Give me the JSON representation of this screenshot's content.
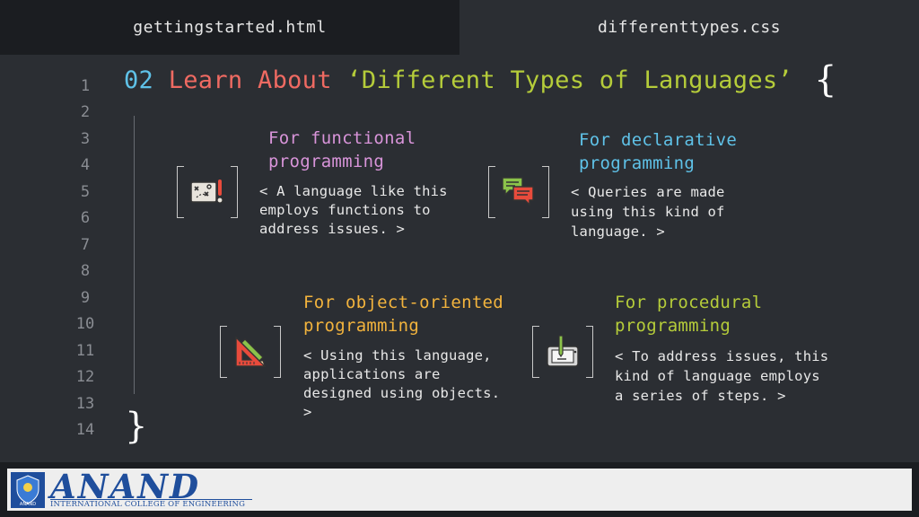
{
  "tabs": [
    {
      "label": "gettingstarted.html",
      "active": true
    },
    {
      "label": "differenttypes.css",
      "active": false
    }
  ],
  "line_numbers": [
    "1",
    "2",
    "3",
    "4",
    "5",
    "6",
    "7",
    "8",
    "9",
    "10",
    "11",
    "12",
    "13",
    "14"
  ],
  "heading": {
    "number": "02",
    "keyword": "Learn About",
    "string": "‘Different Types of Languages’",
    "open_brace": "{",
    "close_brace": "}"
  },
  "items": [
    {
      "title_1": "For functional",
      "title_2": "programming",
      "desc_1": "< A language like this",
      "desc_2": "employs functions to",
      "desc_3": "address issues. >",
      "desc_4": "",
      "icon": "strategy-board-icon",
      "color": "#d894d9"
    },
    {
      "title_1": "For declarative",
      "title_2": "programming",
      "desc_1": "< Queries are made",
      "desc_2": "using this kind of",
      "desc_3": "language. >",
      "desc_4": "",
      "icon": "chat-bubbles-icon",
      "color": "#5fc2e8"
    },
    {
      "title_1": "For object-oriented",
      "title_2": "programming",
      "desc_1": "< Using this language,",
      "desc_2": "applications are",
      "desc_3": "designed using objects.",
      "desc_4": ">",
      "icon": "ruler-pencil-icon",
      "color": "#f2b33d"
    },
    {
      "title_1": "For procedural",
      "title_2": "programming",
      "desc_1": "< To address issues, this",
      "desc_2": "kind of language employs",
      "desc_3": "a series of steps. >",
      "desc_4": "",
      "icon": "drawing-tablet-icon",
      "color": "#b5cc3a"
    }
  ],
  "footer": {
    "brand": "ANAND",
    "subtitle": "INTERNATIONAL COLLEGE OF ENGINEERING",
    "emblem_text": "ANAND",
    "brand_color": "#1f4e9c"
  },
  "colors": {
    "background": "#2b2e33",
    "tab_active": "#1b1d21"
  }
}
